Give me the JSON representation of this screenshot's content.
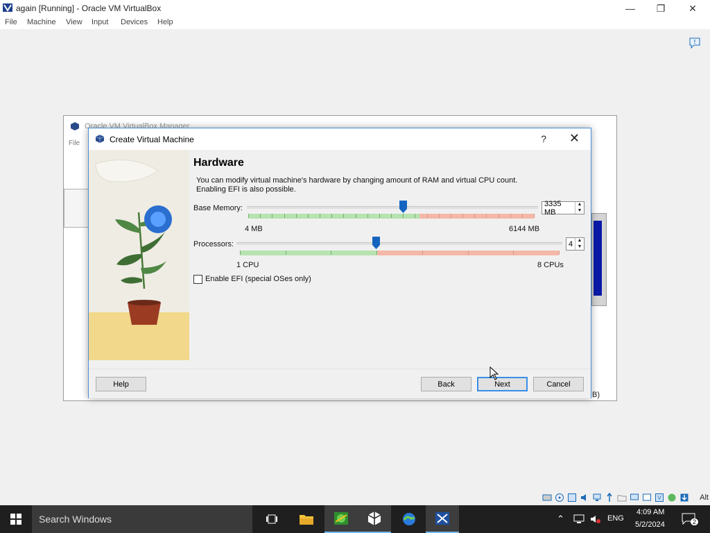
{
  "host": {
    "title": "again [Running] - Oracle VM VirtualBox",
    "menu": [
      "File",
      "Machine",
      "View",
      "Input",
      "Devices",
      "Help"
    ]
  },
  "manager": {
    "title": "Oracle VM VirtualBox Manager",
    "file_menu": "File",
    "bottom_text": "B)"
  },
  "dialog": {
    "title": "Create Virtual Machine",
    "help_glyph": "?",
    "close_glyph": "✕",
    "heading": "Hardware",
    "description_line1": "You can modify virtual machine's hardware by changing amount of RAM and virtual CPU count.",
    "description_line2": "Enabling EFI is also possible.",
    "base_memory": {
      "label": "Base Memory:",
      "value": "3335 MB",
      "min_label": "4 MB",
      "max_label": "6144 MB",
      "level": 0.543
    },
    "processors": {
      "label": "Processors:",
      "value": "4",
      "min_label": "1 CPU",
      "max_label": "8 CPUs",
      "level": 0.4286
    },
    "efi_checkbox": {
      "label": "Enable EFI (special OSes only)",
      "checked": false
    },
    "buttons": {
      "help": "Help",
      "back": "Back",
      "next": "Next",
      "cancel": "Cancel"
    }
  },
  "status_bar": {
    "alt_label": "Alt"
  },
  "taskbar": {
    "search_placeholder": "Search Windows",
    "language": "ENG",
    "time": "4:09 AM",
    "date": "5/2/2024",
    "notification_count": "2"
  },
  "colors": {
    "accent": "#3a8ee6",
    "slider_thumb": "#1565c0",
    "safe_green": "#b6e3b0",
    "warn_red": "#f4b8a8"
  }
}
